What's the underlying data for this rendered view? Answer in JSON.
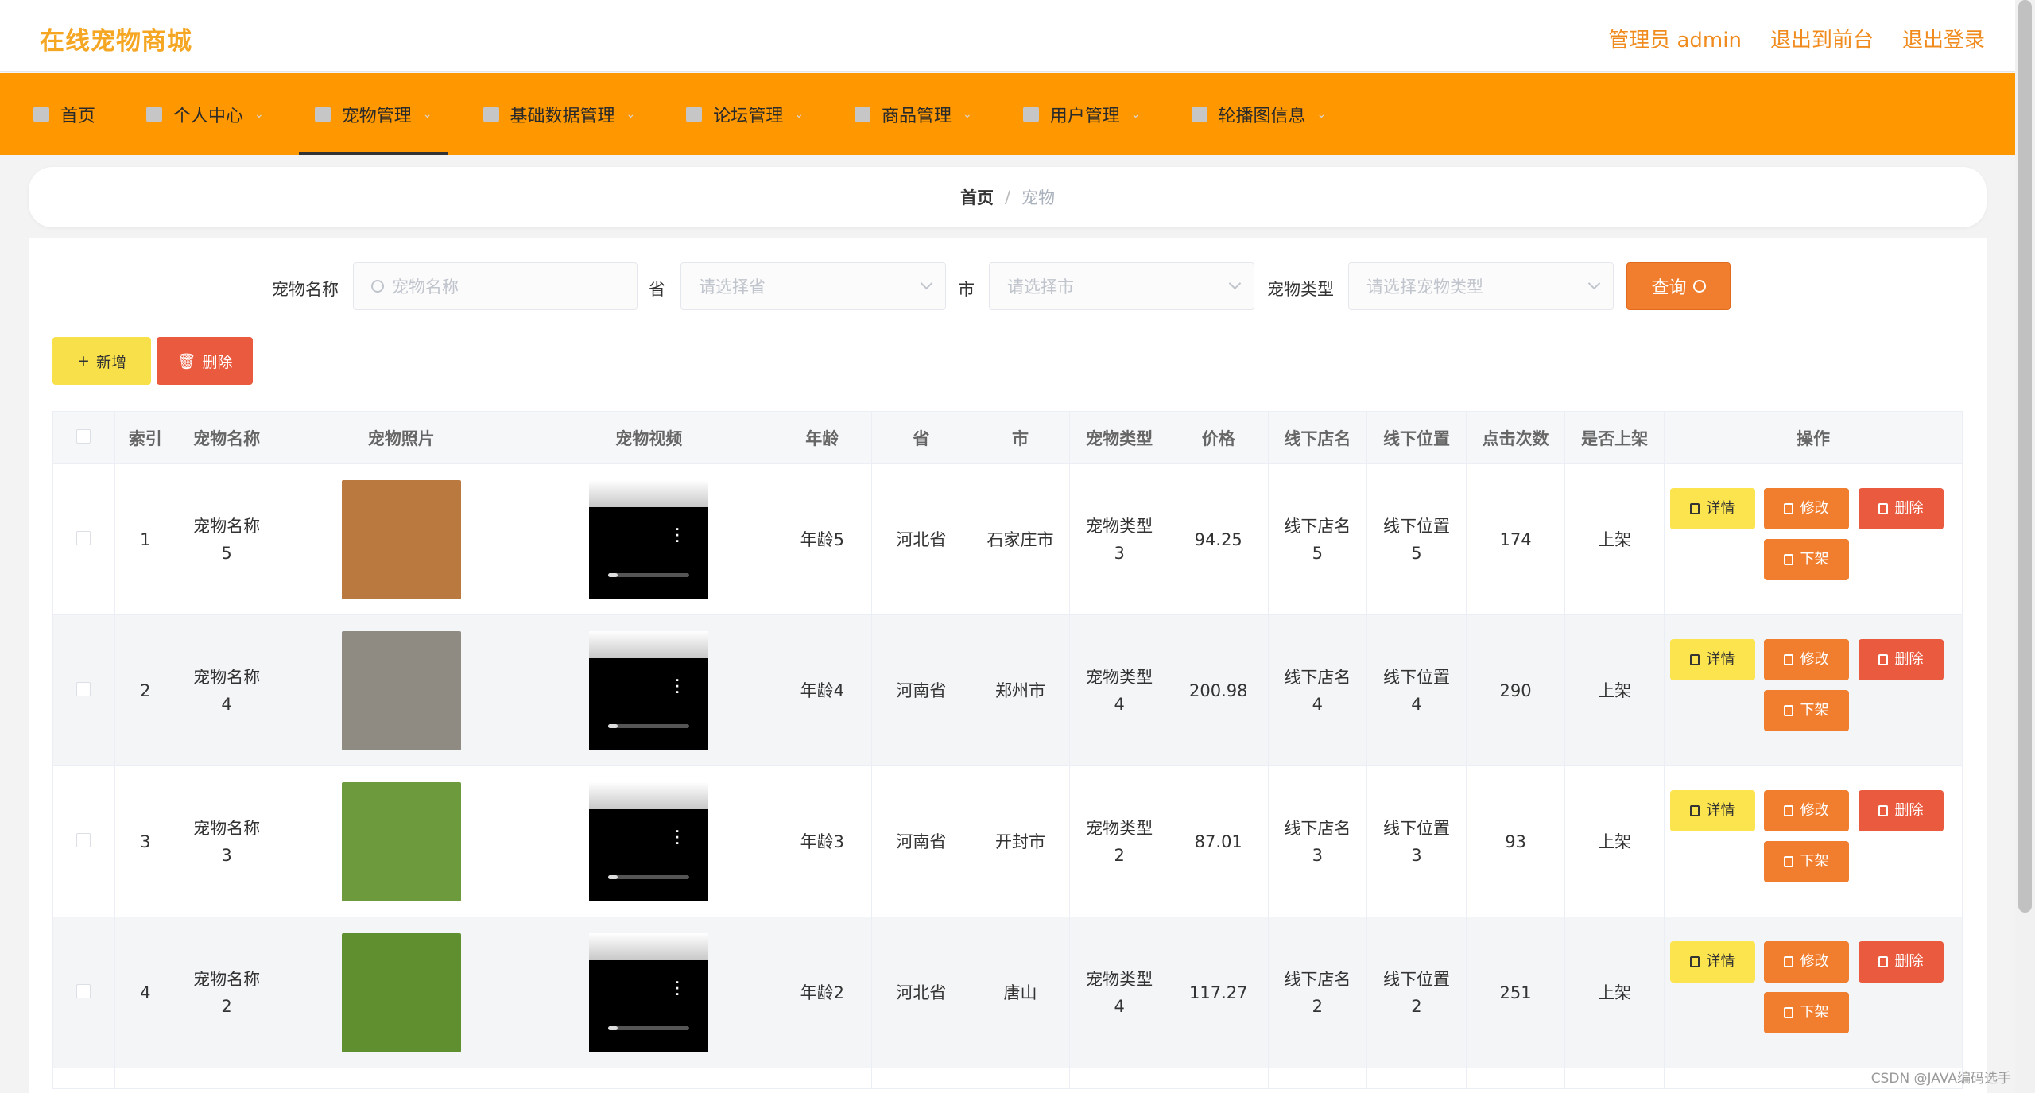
{
  "header": {
    "app_title": "在线宠物商城",
    "admin_label": "管理员 admin",
    "to_front_label": "退出到前台",
    "logout_label": "退出登录"
  },
  "nav": {
    "items": [
      {
        "label": "首页",
        "icon": "home-icon"
      },
      {
        "label": "个人中心",
        "icon": "user-icon"
      },
      {
        "label": "宠物管理",
        "icon": "grid-icon"
      },
      {
        "label": "基础数据管理",
        "icon": "data-icon"
      },
      {
        "label": "论坛管理",
        "icon": "forum-icon"
      },
      {
        "label": "商品管理",
        "icon": "goods-icon"
      },
      {
        "label": "用户管理",
        "icon": "users-icon"
      },
      {
        "label": "轮播图信息",
        "icon": "carousel-icon"
      }
    ],
    "active_index": 2
  },
  "breadcrumb": {
    "home": "首页",
    "current": "宠物"
  },
  "search": {
    "name_label": "宠物名称",
    "name_placeholder": "宠物名称",
    "province_label": "省",
    "province_placeholder": "请选择省",
    "city_label": "市",
    "city_placeholder": "请选择市",
    "type_label": "宠物类型",
    "type_placeholder": "请选择宠物类型",
    "query_button": "查询"
  },
  "actions": {
    "add": "新增",
    "delete": "删除"
  },
  "table": {
    "headers": [
      "索引",
      "宠物名称",
      "宠物照片",
      "宠物视频",
      "年龄",
      "省",
      "市",
      "宠物类型",
      "价格",
      "线下店名",
      "线下位置",
      "点击次数",
      "是否上架",
      "操作"
    ],
    "row_buttons": {
      "detail": "详情",
      "edit": "修改",
      "delete": "删除",
      "off_shelf": "下架"
    },
    "rows": [
      {
        "index": "1",
        "name": "宠物名称\n5",
        "age": "年龄5",
        "province": "河北省",
        "city": "石家庄市",
        "type": "宠物类型\n3",
        "price": "94.25",
        "shop": "线下店名\n5",
        "location": "线下位置\n5",
        "clicks": "174",
        "on_shelf": "上架",
        "photo_color": "#b9793f"
      },
      {
        "index": "2",
        "name": "宠物名称\n4",
        "age": "年龄4",
        "province": "河南省",
        "city": "郑州市",
        "type": "宠物类型\n4",
        "price": "200.98",
        "shop": "线下店名\n4",
        "location": "线下位置\n4",
        "clicks": "290",
        "on_shelf": "上架",
        "photo_color": "#8f8a82"
      },
      {
        "index": "3",
        "name": "宠物名称\n3",
        "age": "年龄3",
        "province": "河南省",
        "city": "开封市",
        "type": "宠物类型\n2",
        "price": "87.01",
        "shop": "线下店名\n3",
        "location": "线下位置\n3",
        "clicks": "93",
        "on_shelf": "上架",
        "photo_color": "#6e9a3e"
      },
      {
        "index": "4",
        "name": "宠物名称\n2",
        "age": "年龄2",
        "province": "河北省",
        "city": "唐山",
        "type": "宠物类型\n4",
        "price": "117.27",
        "shop": "线下店名\n2",
        "location": "线下位置\n2",
        "clicks": "251",
        "on_shelf": "上架",
        "photo_color": "#5f8f2e"
      }
    ]
  },
  "watermark": "CSDN @JAVA编码选手",
  "colors": {
    "accent": "#ff9800",
    "logo": "#f5a623",
    "danger": "#ea5a3f",
    "warning": "#f07e2e",
    "yellow": "#fce44e"
  }
}
